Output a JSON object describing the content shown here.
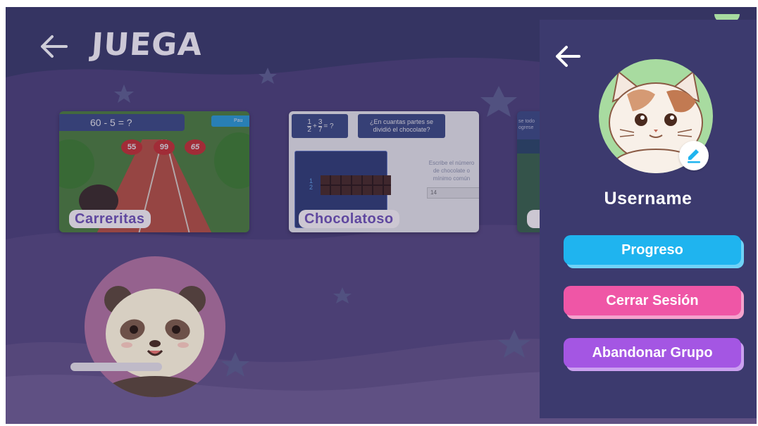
{
  "header": {
    "title": "JUEGA"
  },
  "games": [
    {
      "label": "Carreritas",
      "equation": "60 - 5 = ?",
      "pause_label": "Pau",
      "answers": [
        "55",
        "99",
        "65"
      ]
    },
    {
      "label": "Chocolatoso",
      "fraction_a_num": "1",
      "fraction_a_den": "2",
      "fraction_b_num": "3",
      "fraction_b_den": "7",
      "equation_suffix": "= ?",
      "question_line1": "¿En cuantas partes se",
      "question_line2": "dividió el chocolate?",
      "hint_line1": "Escribe el número",
      "hint_line2": "de chocolate o",
      "hint_line3": "mínimo común",
      "answer_value": "14"
    },
    {
      "label": "",
      "partial_text_1": "se todo",
      "partial_text_2": "ogrese"
    }
  ],
  "side_panel": {
    "username": "Username",
    "buttons": {
      "progress": "Progreso",
      "logout": "Cerrar Sesión",
      "leave_group": "Abandonar Grupo"
    }
  },
  "icons": {
    "back": "arrow-left-icon",
    "edit": "pencil-icon"
  },
  "colors": {
    "background": "#3b3a6a",
    "panel": "#3c3a6e",
    "progress": "#1fb4ef",
    "logout": "#ef56a6",
    "leave_group": "#a456e3",
    "card_label_text": "#6a4fb0"
  }
}
